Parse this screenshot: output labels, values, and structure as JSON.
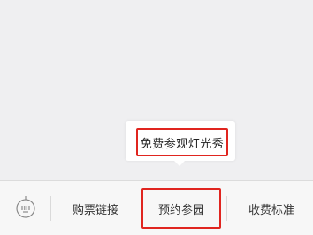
{
  "popup": {
    "items": [
      {
        "label": "免费参观灯光秀"
      }
    ]
  },
  "menubar": {
    "items": [
      {
        "label": "购票链接"
      },
      {
        "label": "预约参园"
      },
      {
        "label": "收费标准"
      }
    ]
  },
  "colors": {
    "highlight": "#e0251f",
    "background": "#efeff1",
    "menubar": "#f7f7f7"
  }
}
